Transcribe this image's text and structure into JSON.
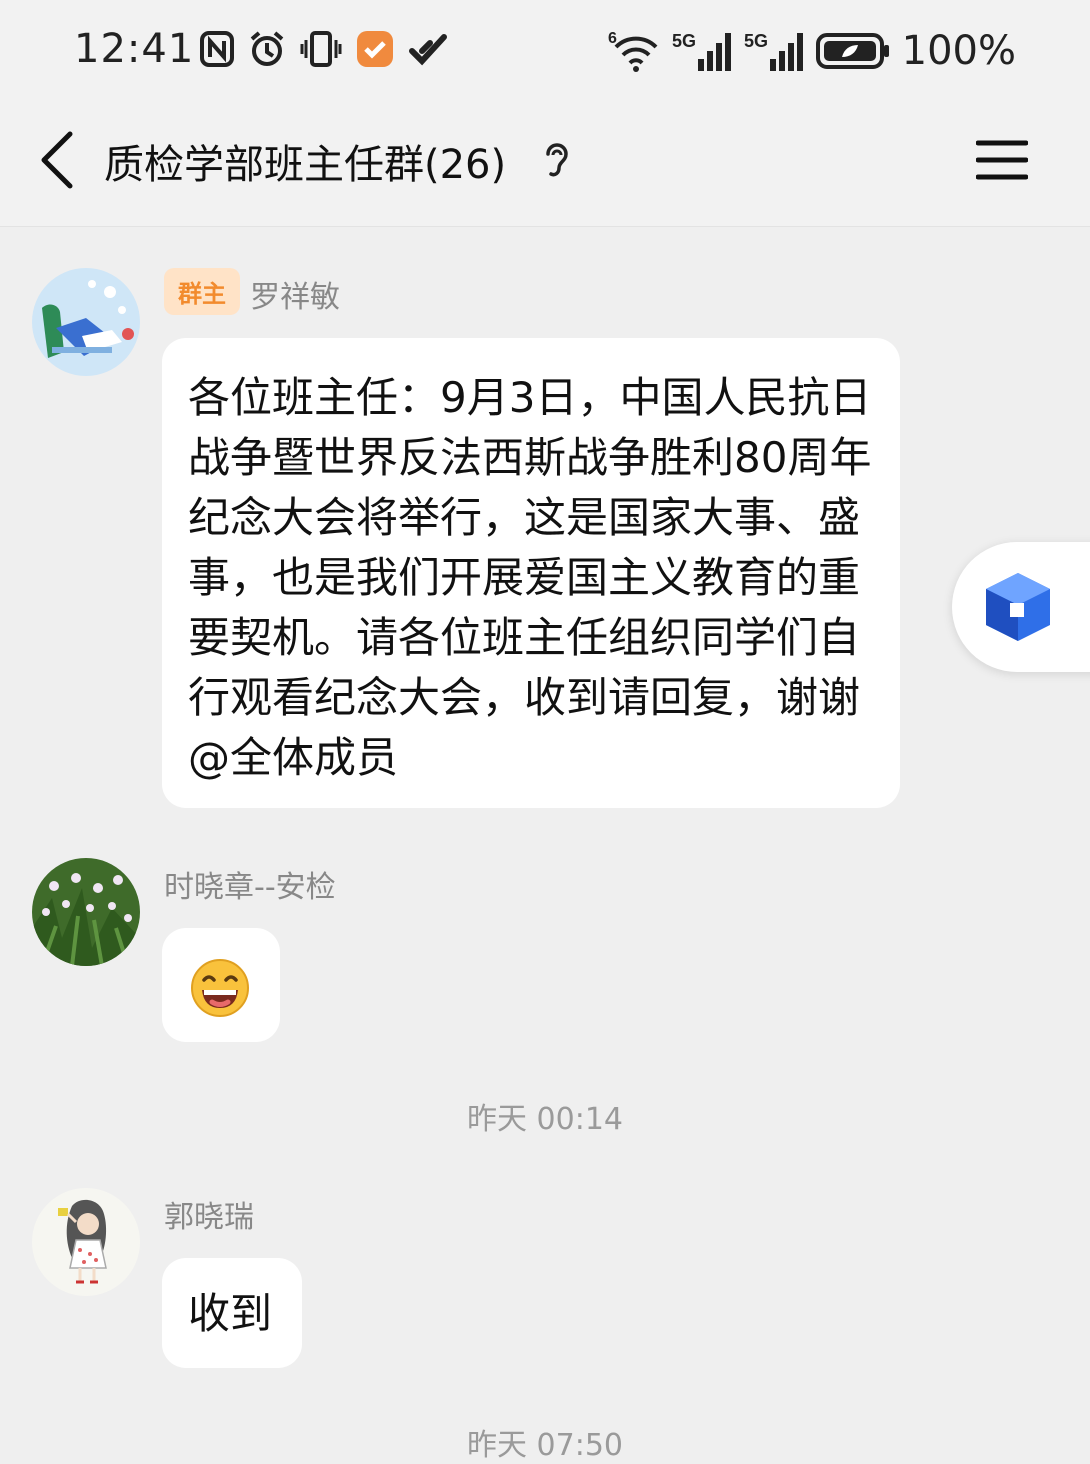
{
  "status_bar": {
    "time": "12:41",
    "network_label_1": "5G",
    "network_label_2": "5G",
    "wifi_label": "6",
    "battery": "100%"
  },
  "header": {
    "title": "质检学部班主任群(26)"
  },
  "messages": [
    {
      "badge": "群主",
      "sender": "罗祥敏",
      "text": "各位班主任：9月3日，中国人民抗日战争暨世界反法西斯战争胜利80周年纪念大会将举行，这是国家大事、盛事，也是我们开展爱国主义教育的重要契机。请各位班主任组织同学们自行观看纪念大会，收到请回复，谢谢@全体成员"
    },
    {
      "sender": "时晓章--安检",
      "emoji": "grinning-face"
    },
    {
      "timestamp": "昨天 00:14"
    },
    {
      "sender": "郭晓瑞",
      "text": "收到"
    },
    {
      "timestamp": "昨天 07:50"
    }
  ],
  "colors": {
    "badge_bg": "#ffe3c7",
    "badge_text": "#f28b2e",
    "float_icon": "#2f6fe8"
  }
}
